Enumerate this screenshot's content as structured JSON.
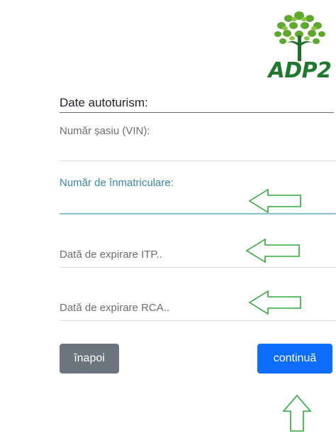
{
  "logo": {
    "text": "ADP2",
    "brand_color": "#1f7a2e",
    "icon": "tree-icon"
  },
  "form": {
    "section_title": "Date autoturism:",
    "vin_label": "Număr șasiu (VIN):",
    "plate_label": "Număr de înmatriculare:",
    "itp_placeholder": "Dată de expirare ITP..",
    "rca_placeholder": "Dată de expirare RCA..",
    "vin_value": "",
    "plate_value": "",
    "itp_value": "",
    "rca_value": ""
  },
  "buttons": {
    "back_label": "înapoi",
    "continue_label": "continuă"
  },
  "colors": {
    "focus_label": "#3a86ad",
    "arrow": "#2eaa3a",
    "back_button": "#6c757d",
    "continue_button": "#0d6efd"
  },
  "annotations": {
    "arrow_icon_left": "arrow-left-outline-icon",
    "arrow_icon_up": "arrow-up-outline-icon"
  }
}
